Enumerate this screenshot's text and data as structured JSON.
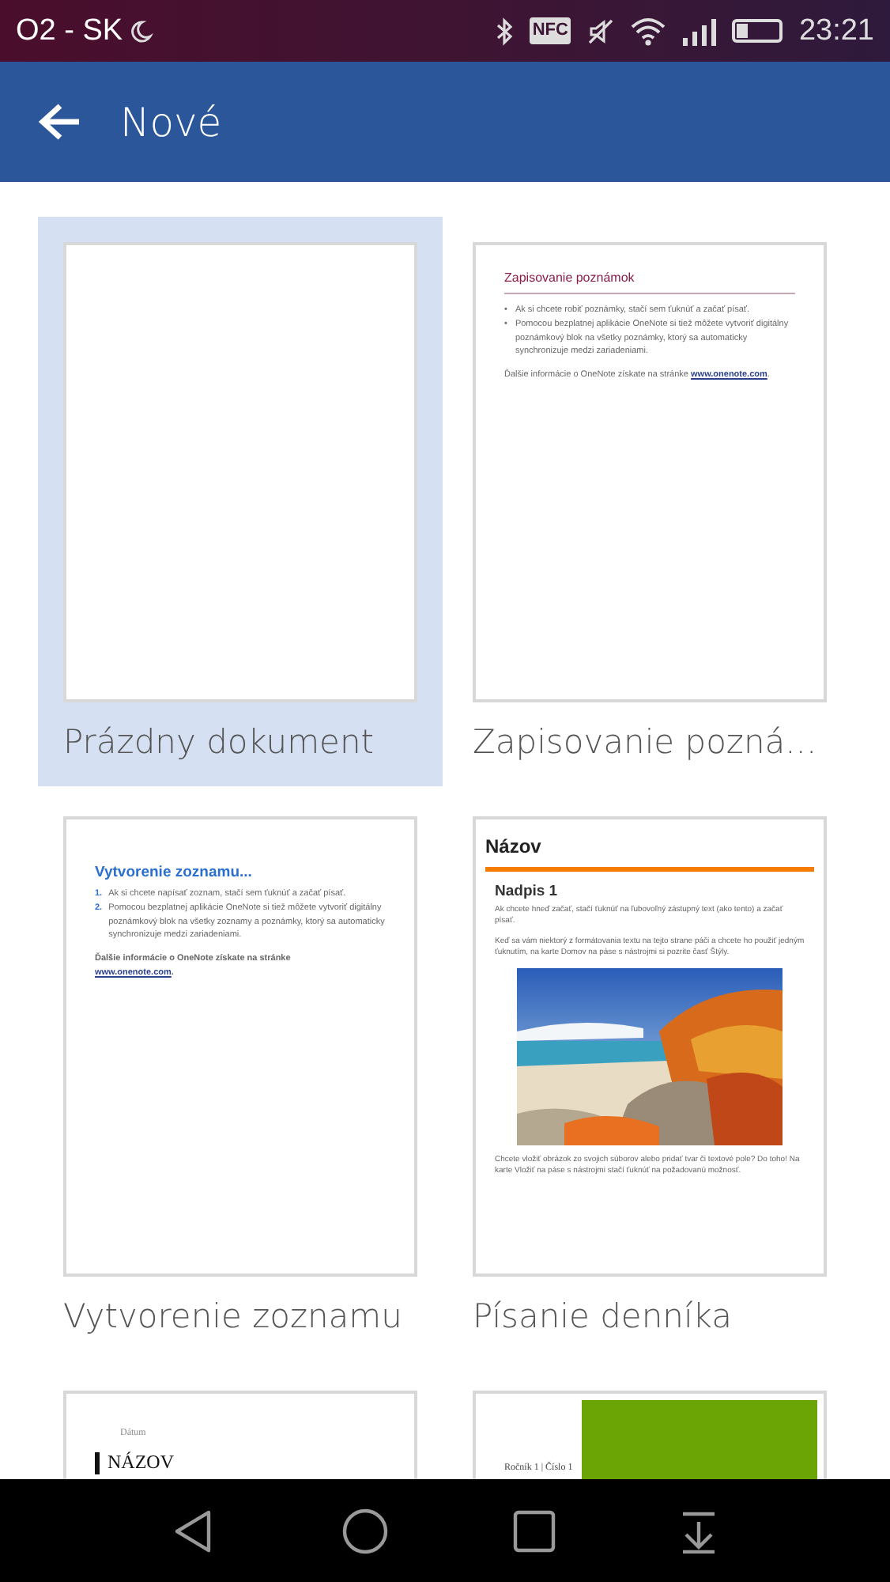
{
  "status_bar": {
    "carrier": "O2 - SK",
    "nfc_label": "NFC",
    "time": "23:21"
  },
  "app_bar": {
    "title": "Nové"
  },
  "templates": [
    {
      "kind": "blank",
      "title": "Prázdny dokument",
      "selected": true
    },
    {
      "kind": "notes",
      "title": "Zapisovanie pozná...",
      "selected": false,
      "heading": "Zapisovanie poznámok",
      "bullet_marker": "•",
      "bullets": [
        "Ak si chcete robiť poznámky, stačí sem ťuknúť a začať písať.",
        "Pomocou bezplatnej aplikácie OneNote si tiež môžete vytvoriť digitálny poznámkový blok na všetky poznámky, ktorý sa automaticky synchronizuje medzi zariadeniami."
      ],
      "footer": "Ďalšie informácie o OneNote získate na stránke",
      "link": "www.onenote.com",
      "footer_end": "."
    },
    {
      "kind": "list",
      "title": "Vytvorenie zoznamu",
      "selected": false,
      "heading": "Vytvorenie zoznamu...",
      "items": [
        {
          "number": "1.",
          "text": "Ak si chcete napísať zoznam, stačí sem ťuknúť a začať písať."
        },
        {
          "number": "2.",
          "text": "Pomocou bezplatnej aplikácie OneNote si tiež môžete vytvoriť digitálny poznámkový blok na všetky zoznamy a poznámky, ktorý sa automaticky synchronizuje medzi zariadeniami."
        }
      ],
      "footer": "Ďalšie informácie o OneNote získate na stránke",
      "link": "www.onenote.com",
      "footer_end": "."
    },
    {
      "kind": "journal",
      "title": "Písanie denníka",
      "selected": false,
      "heading": "Názov",
      "subheading": "Nadpis 1",
      "paragraphs": [
        "Ak chcete hneď začať, stačí ťuknúť na ľubovoľný zástupný text (ako tento) a začať písať.",
        "Keď sa vám niektorý z formátovania textu na tejto strane páči a chcete ho použiť jedným ťuknutím, na karte Domov na páse s nástrojmi si pozrite časť Štýly."
      ],
      "caption": "Chcete vložiť obrázok zo svojich súborov alebo pridať tvar či textové pole? Do toho! Na karte Vložiť na páse s nástrojmi stačí ťuknúť na požadovanú možnosť."
    },
    {
      "kind": "report",
      "selected": false,
      "date": "Dátum",
      "heading": "NÁZOV"
    },
    {
      "kind": "bulletin",
      "selected": false,
      "issue": "Ročník 1 | Číslo 1"
    }
  ]
}
